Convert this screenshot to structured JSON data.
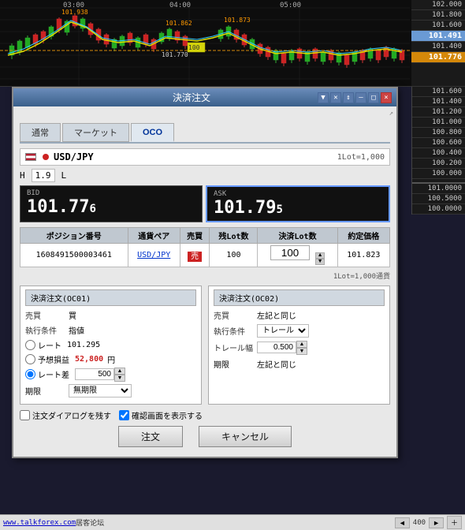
{
  "chart": {
    "times": [
      "03:00",
      "04:00",
      "05:00"
    ],
    "prices_right": [
      "102.000",
      "101.800",
      "101.600",
      "101.491",
      "101.400",
      "101.200",
      "101.000",
      "100.800",
      "100.600",
      "100.400",
      "100.200",
      "100.000"
    ],
    "current_price": "101.776",
    "price_labels": [
      "101.938",
      "101.862",
      "101.873",
      "101.770"
    ],
    "right_panel_bottom": [
      "101.0000",
      "100.5000",
      "100.0000"
    ],
    "zoom": "400"
  },
  "dialog": {
    "title": "決済注文",
    "tabs": [
      "通常",
      "マーケット",
      "OCO"
    ],
    "active_tab": "OCO",
    "symbol": "USD/JPY",
    "lot_size": "1Lot=1,000",
    "h_label": "H",
    "h_value": "1.9",
    "l_label": "L",
    "bid_label": "BID",
    "bid_price_main": "101.77",
    "bid_price_small": "6",
    "ask_label": "ASK",
    "ask_price_main": "101.79",
    "ask_price_small": "5",
    "table": {
      "headers": [
        "ポジション番号",
        "通貨ペア",
        "売買",
        "残Lot数",
        "決済Lot数",
        "約定価格"
      ],
      "row": {
        "position_no": "1608491500003461",
        "currency": "USD/JPY",
        "side": "売",
        "remaining_lots": "100",
        "settle_lots": "100",
        "exec_price": "101.823"
      }
    },
    "lot_note": "1Lot=1,000通貨",
    "panel1": {
      "title": "決済注文(OC01)",
      "fields": {
        "sell_buy_label": "売買",
        "sell_buy_value": "買",
        "exec_cond_label": "執行条件",
        "exec_cond_value": "指値",
        "rate_label": "レート",
        "rate_value": "101.295",
        "profit_label": "予想損益",
        "profit_value": "52,800",
        "profit_unit": "円",
        "rate_diff_label": "レート差",
        "rate_diff_value": "500",
        "period_label": "期限",
        "period_value": "無期限"
      }
    },
    "panel2": {
      "title": "決済注文(OC02)",
      "fields": {
        "sell_buy_label": "売買",
        "sell_buy_value": "左記と同じ",
        "exec_cond_label": "執行条件",
        "exec_cond_value": "トレール",
        "trail_width_label": "トレール幅",
        "trail_width_value": "0.500",
        "period_label": "期限",
        "period_value": "左記と同じ"
      }
    },
    "footer": {
      "keep_dialog_label": "注文ダイアログを残す",
      "confirm_label": "確認画面を表示する",
      "order_btn": "注文",
      "cancel_btn": "キャンセル"
    }
  },
  "bottom_bar": {
    "site": "www.talkforex.com",
    "site_suffix": " 居客论坛",
    "zoom": "400",
    "nav_prev": "◄",
    "nav_next": "►",
    "plus": "＋"
  }
}
